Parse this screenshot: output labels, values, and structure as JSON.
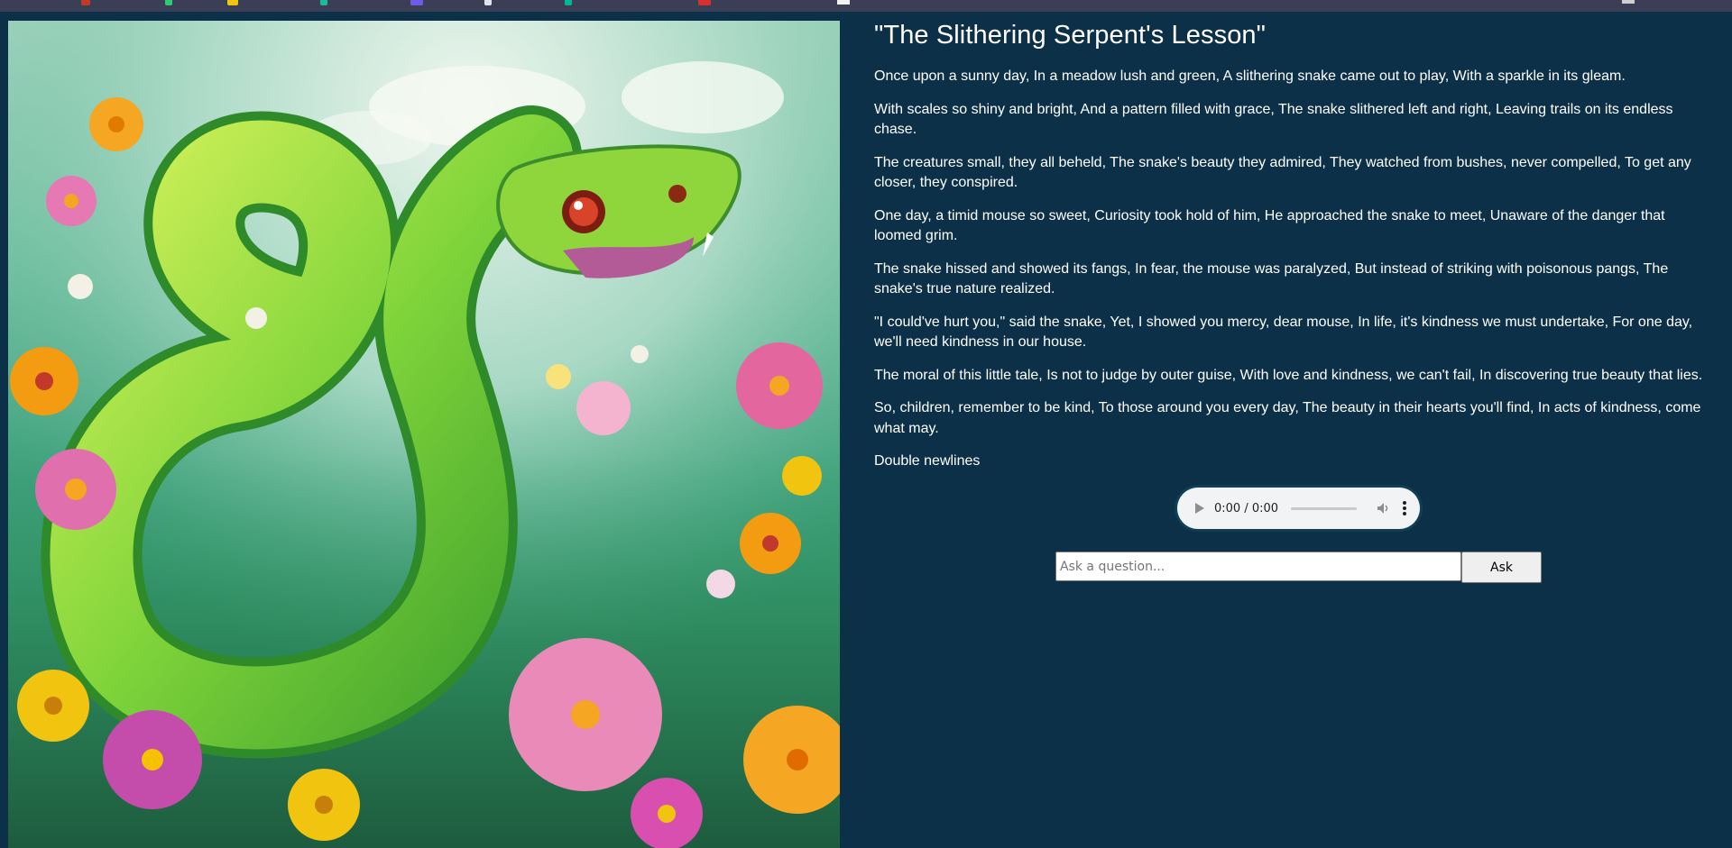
{
  "story": {
    "title": "\"The Slithering Serpent's Lesson\"",
    "paragraphs": [
      "Once upon a sunny day, In a meadow lush and green, A slithering snake came out to play, With a sparkle in its gleam.",
      "With scales so shiny and bright, And a pattern filled with grace, The snake slithered left and right, Leaving trails on its endless chase.",
      "The creatures small, they all beheld, The snake's beauty they admired, They watched from bushes, never compelled, To get any closer, they conspired.",
      "One day, a timid mouse so sweet, Curiosity took hold of him, He approached the snake to meet, Unaware of the danger that loomed grim.",
      "The snake hissed and showed its fangs, In fear, the mouse was paralyzed, But instead of striking with poisonous pangs, The snake's true nature realized.",
      "\"I could've hurt you,\" said the snake, Yet, I showed you mercy, dear mouse, In life, it's kindness we must undertake, For one day, we'll need kindness in our house.",
      "The moral of this little tale, Is not to judge by outer guise, With love and kindness, we can't fail, In discovering true beauty that lies.",
      "So, children, remember to be kind, To those around you every day, The beauty in their hearts you'll find, In acts of kindness, come what may.",
      "Double newlines"
    ]
  },
  "audio": {
    "time": "0:00 / 0:00"
  },
  "ask": {
    "placeholder": "Ask a question...",
    "button_label": "Ask"
  },
  "colors": {
    "background": "#0d3049",
    "text": "#ffffff"
  }
}
